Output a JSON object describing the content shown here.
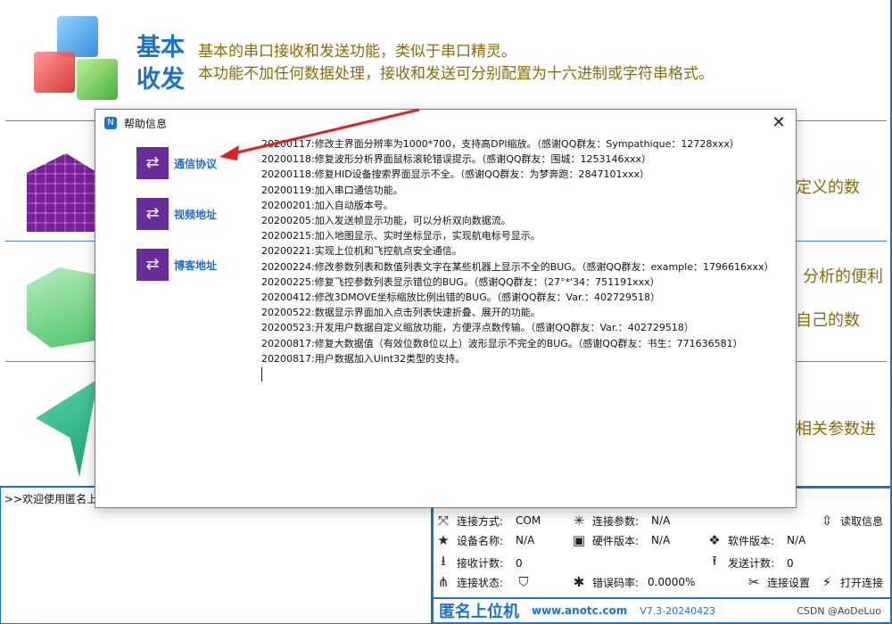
{
  "feature": {
    "title": "基本收发",
    "desc_line1": "基本的串口接收和发送功能，类似于串口精灵。",
    "desc_line2": "本功能不加任何数据处理，接收和发送可分别配置为十六进制或字符串格式。"
  },
  "side_snippets": [
    "定义的数",
    "分析的便利",
    "自己的数",
    "相关参数进"
  ],
  "log": {
    "text": ">>欢迎使用匿名上位"
  },
  "status": {
    "connection_mode_label": "连接方式:",
    "connection_mode_value": "COM",
    "connection_params_label": "连接参数:",
    "connection_params_value": "N/A",
    "read_info_label": "读取信息",
    "device_name_label": "设备名称:",
    "device_name_value": "N/A",
    "hw_version_label": "硬件版本:",
    "hw_version_value": "N/A",
    "sw_version_label": "软件版本:",
    "sw_version_value": "N/A",
    "rx_count_label": "接收计数:",
    "rx_count_value": "0",
    "tx_count_label": "发送计数:",
    "tx_count_value": "0",
    "conn_state_label": "连接状态:",
    "error_rate_label": "错误码率:",
    "error_rate_value": "0.0000%",
    "conn_settings_label": "连接设置",
    "open_conn_label": "打开连接"
  },
  "brand": {
    "name": "匿名上位机",
    "url": "www.anotc.com",
    "version": "V7.3-20240423"
  },
  "watermark": "CSDN @AoDeLuo",
  "dialog": {
    "title": "帮助信息",
    "close": "✕",
    "nav": [
      "通信协议",
      "视频地址",
      "博客地址"
    ],
    "changelog": [
      "20200117:修改主界面分辨率为1000*700，支持高DPI缩放。（感谢QQ群友：Sympathique：12728xxx）",
      "20200118:修复波形分析界面鼠标滚轮错误提示。（感谢QQ群友：围城：1253146xxx）",
      "20200118:修复HID设备搜索界面显示不全。（感谢QQ群友：为梦奔跑：2847101xxx）",
      "20200119:加入串口通信功能。",
      "20200201:加入自动版本号。",
      "20200205:加入发送帧显示功能，可以分析双向数据流。",
      "20200215:加入地图显示、实时坐标显示，实现航电标号显示。",
      "20200221:实现上位机和飞控航点安全通信。",
      "20200224:修改参数列表和数值列表文字在某些机器上显示不全的BUG。（感谢QQ群友：example：1796616xxx）",
      "20200225:修复飞控参数列表显示错位的BUG。（感谢QQ群友：（27°*'34：751191xxx）",
      "20200412:修改3DMOVE坐标缩放比例出错的BUG。（感谢QQ群友：Var.：402729518）",
      "20200522:数据显示界面加入点击列表快速折叠、展开的功能。",
      "20200523:开发用户数据自定义缩放功能，方便浮点数传输。（感谢QQ群友：Var.：402729518）",
      "20200817:修复大数据值（有效位数8位以上）波形显示不完全的BUG。（感谢QQ群友：书生：771636581）",
      "20200817:用户数据加入Uint32类型的支持。"
    ]
  },
  "colors": {
    "accent": "#1a73c8",
    "nav_icon": "#6a2c9a",
    "desc_text": "#8a6b00",
    "arrow": "#e02020"
  }
}
